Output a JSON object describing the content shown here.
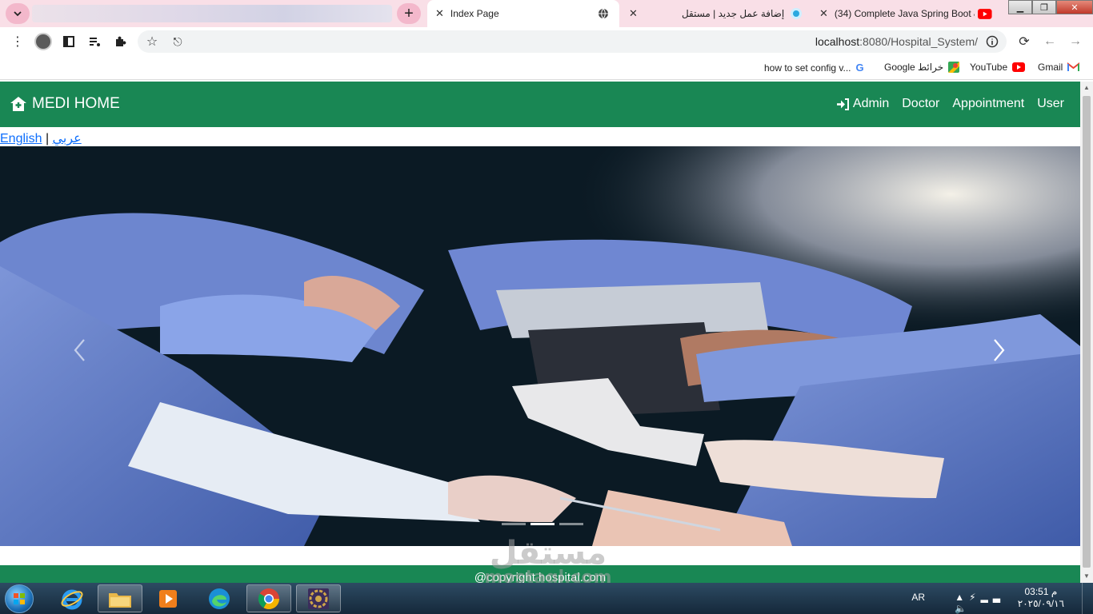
{
  "browser": {
    "tabs": [
      {
        "title": "Index Page",
        "active": true
      },
      {
        "title": "إضافة عمل جديد | مستقل",
        "active": false
      },
      {
        "title": "(34) Complete Java Spring Boot &",
        "active": false
      }
    ],
    "new_tab_label": "+",
    "url_host": "localhost",
    "url_path": ":8080/Hospital_System/",
    "bookmarks": [
      {
        "label": "how to set config v...",
        "icon": "google-g-icon"
      },
      {
        "label": "Google خرائط",
        "icon": "google-maps-icon"
      },
      {
        "label": "YouTube",
        "icon": "youtube-icon"
      },
      {
        "label": "Gmail",
        "icon": "gmail-icon"
      }
    ]
  },
  "site": {
    "brand": "MEDI HOME",
    "nav": [
      "Admin",
      "Doctor",
      "Appointment",
      "User"
    ],
    "lang_english": "English",
    "lang_separator": "|",
    "lang_arabic": "عربي",
    "footer": "@copyright hospital.com",
    "theme_color": "#198754"
  },
  "carousel": {
    "slide_count": 3,
    "active_index": 1
  },
  "watermark": {
    "arabic": "مستقل",
    "latin": "mostaql.com"
  },
  "taskbar": {
    "language": "AR",
    "time": "03:51 م",
    "date": "٢٠٢٥/٠٩/١٦"
  }
}
